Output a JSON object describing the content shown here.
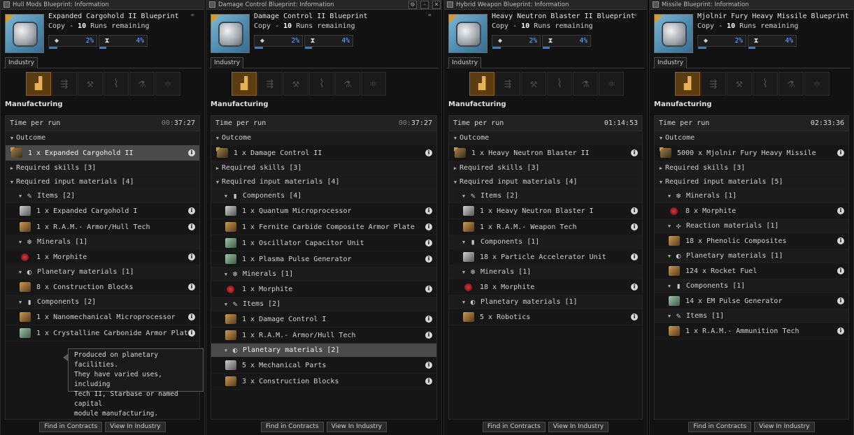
{
  "windows": [
    {
      "title": "Hull Mods Blueprint: Information",
      "name": "Expanded Cargohold II Blueprint",
      "copy_text": "Copy - ",
      "runs": "10",
      "runs_suffix": " Runs remaining",
      "me": "2%",
      "te": "4%",
      "tab": "Industry",
      "section": "Manufacturing",
      "time_label": "Time per run",
      "time_dim": "00:",
      "time": "37:27",
      "rows": [
        {
          "t": "hdr",
          "indent": 0,
          "label": "Outcome"
        },
        {
          "t": "item",
          "indent": 0,
          "label": "1 x Expanded Cargohold II",
          "icon": "bp",
          "sel": true,
          "info": true
        },
        {
          "t": "hdr",
          "indent": 0,
          "label": "Required skills [3]",
          "collapsed": true
        },
        {
          "t": "hdr",
          "indent": 0,
          "label": "Required input materials [4]"
        },
        {
          "t": "sub",
          "indent": 1,
          "label": "Items [2]",
          "glyph": "✎"
        },
        {
          "t": "item",
          "indent": 1,
          "label": "1 x Expanded Cargohold I",
          "icon": "gray",
          "info": true
        },
        {
          "t": "item",
          "indent": 1,
          "label": "1 x R.A.M.- Armor/Hull Tech",
          "icon": "brown",
          "info": true
        },
        {
          "t": "sub",
          "indent": 1,
          "label": "Minerals [1]",
          "glyph": "❄"
        },
        {
          "t": "item",
          "indent": 1,
          "label": "1 x Morphite",
          "icon": "red",
          "info": true
        },
        {
          "t": "sub",
          "indent": 1,
          "label": "Planetary materials [1]",
          "glyph": "◐"
        },
        {
          "t": "item",
          "indent": 1,
          "label": "8 x Construction Blocks",
          "icon": "brown",
          "info": true
        },
        {
          "t": "sub",
          "indent": 1,
          "label": "Components [2]",
          "glyph": "▮"
        },
        {
          "t": "item",
          "indent": 1,
          "label": "1 x Nanomechanical Microprocessor",
          "icon": "brown",
          "info": true
        },
        {
          "t": "item",
          "indent": 1,
          "label": "1 x Crystalline Carbonide Armor Plate",
          "icon": "green",
          "info": true
        }
      ],
      "find_label": "Find in Contracts",
      "view_label": "View In Industry"
    },
    {
      "title": "Damage Control Blueprint: Information",
      "name": "Damage Control II Blueprint",
      "copy_text": "Copy - ",
      "runs": "10",
      "runs_suffix": " Runs remaining",
      "me": "2%",
      "te": "4%",
      "tab": "Industry",
      "section": "Manufacturing",
      "time_label": "Time per run",
      "time_dim": "00:",
      "time": "37:27",
      "rows": [
        {
          "t": "hdr",
          "indent": 0,
          "label": "Outcome"
        },
        {
          "t": "item",
          "indent": 0,
          "label": "1 x Damage Control II",
          "icon": "bp",
          "info": true
        },
        {
          "t": "hdr",
          "indent": 0,
          "label": "Required skills [3]",
          "collapsed": true
        },
        {
          "t": "hdr",
          "indent": 0,
          "label": "Required input materials [4]"
        },
        {
          "t": "sub",
          "indent": 1,
          "label": "Components [4]",
          "glyph": "▮"
        },
        {
          "t": "item",
          "indent": 1,
          "label": "1 x Quantum Microprocessor",
          "icon": "gray",
          "info": true
        },
        {
          "t": "item",
          "indent": 1,
          "label": "1 x Fernite Carbide Composite Armor Plate",
          "icon": "brown",
          "info": true
        },
        {
          "t": "item",
          "indent": 1,
          "label": "1 x Oscillator Capacitor Unit",
          "icon": "green",
          "info": true
        },
        {
          "t": "item",
          "indent": 1,
          "label": "1 x Plasma Pulse Generator",
          "icon": "green",
          "info": true
        },
        {
          "t": "sub",
          "indent": 1,
          "label": "Minerals [1]",
          "glyph": "❄"
        },
        {
          "t": "item",
          "indent": 1,
          "label": "1 x Morphite",
          "icon": "red",
          "info": true
        },
        {
          "t": "sub",
          "indent": 1,
          "label": "Items [2]",
          "glyph": "✎"
        },
        {
          "t": "item",
          "indent": 1,
          "label": "1 x Damage Control I",
          "icon": "brown",
          "info": true
        },
        {
          "t": "item",
          "indent": 1,
          "label": "1 x R.A.M.- Armor/Hull Tech",
          "icon": "brown",
          "info": true
        },
        {
          "t": "sub",
          "indent": 1,
          "label": "Planetary materials [2]",
          "glyph": "◐",
          "sel": true
        },
        {
          "t": "item",
          "indent": 1,
          "label": "5 x Mechanical Parts",
          "icon": "gray",
          "info": true
        },
        {
          "t": "item",
          "indent": 1,
          "label": "3 x Construction Blocks",
          "icon": "brown",
          "info": true
        }
      ],
      "find_label": "Find in Contracts",
      "view_label": "View In Industry"
    },
    {
      "title": "Hybrid Weapon Blueprint: Information",
      "name": "Heavy Neutron Blaster II Blueprint",
      "copy_text": "Copy - ",
      "runs": "10",
      "runs_suffix": " Runs remaining",
      "me": "2%",
      "te": "4%",
      "tab": "Industry",
      "section": "Manufacturing",
      "time_label": "Time per run",
      "time_dim": "",
      "time": "01:14:53",
      "rows": [
        {
          "t": "hdr",
          "indent": 0,
          "label": "Outcome"
        },
        {
          "t": "item",
          "indent": 0,
          "label": "1 x Heavy Neutron Blaster II",
          "icon": "bp",
          "info": true
        },
        {
          "t": "hdr",
          "indent": 0,
          "label": "Required skills [3]",
          "collapsed": true
        },
        {
          "t": "hdr",
          "indent": 0,
          "label": "Required input materials [4]"
        },
        {
          "t": "sub",
          "indent": 1,
          "label": "Items [2]",
          "glyph": "✎"
        },
        {
          "t": "item",
          "indent": 1,
          "label": "1 x Heavy Neutron Blaster I",
          "icon": "gray",
          "info": true
        },
        {
          "t": "item",
          "indent": 1,
          "label": "1 x R.A.M.- Weapon Tech",
          "icon": "brown",
          "info": true
        },
        {
          "t": "sub",
          "indent": 1,
          "label": "Components [1]",
          "glyph": "▮"
        },
        {
          "t": "item",
          "indent": 1,
          "label": "18 x Particle Accelerator Unit",
          "icon": "gray",
          "info": true
        },
        {
          "t": "sub",
          "indent": 1,
          "label": "Minerals [1]",
          "glyph": "❄"
        },
        {
          "t": "item",
          "indent": 1,
          "label": "18 x Morphite",
          "icon": "red",
          "info": true
        },
        {
          "t": "sub",
          "indent": 1,
          "label": "Planetary materials [1]",
          "glyph": "◐"
        },
        {
          "t": "item",
          "indent": 1,
          "label": "5 x Robotics",
          "icon": "brown",
          "info": true
        }
      ],
      "find_label": "Find in Contracts",
      "view_label": "View In Industry"
    },
    {
      "title": "Missile Blueprint: Information",
      "name": "Mjolnir Fury Heavy Missile Blueprint",
      "copy_text": "Copy - ",
      "runs": "10",
      "runs_suffix": " Runs remaining",
      "me": "2%",
      "te": "4%",
      "tab": "Industry",
      "section": "Manufacturing",
      "time_label": "Time per run",
      "time_dim": "",
      "time": "02:33:36",
      "rows": [
        {
          "t": "hdr",
          "indent": 0,
          "label": "Outcome"
        },
        {
          "t": "item",
          "indent": 0,
          "label": "5000 x Mjolnir Fury Heavy Missile",
          "icon": "bp",
          "info": true
        },
        {
          "t": "hdr",
          "indent": 0,
          "label": "Required skills [3]",
          "collapsed": true
        },
        {
          "t": "hdr",
          "indent": 0,
          "label": "Required input materials [5]"
        },
        {
          "t": "sub",
          "indent": 1,
          "label": "Minerals [1]",
          "glyph": "❄"
        },
        {
          "t": "item",
          "indent": 1,
          "label": "8 x Morphite",
          "icon": "red",
          "info": true
        },
        {
          "t": "sub",
          "indent": 1,
          "label": "Reaction materials [1]",
          "glyph": "✣"
        },
        {
          "t": "item",
          "indent": 1,
          "label": "18 x Phenolic Composites",
          "icon": "brown",
          "info": true
        },
        {
          "t": "sub",
          "indent": 1,
          "label": "Planetary materials [1]",
          "glyph": "◐"
        },
        {
          "t": "item",
          "indent": 1,
          "label": "124 x Rocket Fuel",
          "icon": "brown",
          "info": true
        },
        {
          "t": "sub",
          "indent": 1,
          "label": "Components [1]",
          "glyph": "▮"
        },
        {
          "t": "item",
          "indent": 1,
          "label": "14 x EM Pulse Generator",
          "icon": "green",
          "info": true
        },
        {
          "t": "sub",
          "indent": 1,
          "label": "Items [1]",
          "glyph": "✎"
        },
        {
          "t": "item",
          "indent": 1,
          "label": "1 x R.A.M.- Ammunition Tech",
          "icon": "brown",
          "info": true
        }
      ],
      "find_label": "Find in Contracts",
      "view_label": "View In Industry"
    }
  ],
  "tooltip": {
    "lines": [
      "Produced on planetary facilities.",
      "They have varied uses, including",
      "Tech II, Starbase or named capital",
      "module manufacturing."
    ]
  },
  "activity_icons": [
    "manufacturing-icon",
    "research-te-icon",
    "research-me-icon",
    "copying-icon",
    "invention-icon",
    "reactions-icon"
  ],
  "colors": {
    "accent": "#2b7ed1",
    "selected_activity": "#5c3d12",
    "selected_row": "#4a4a4a"
  }
}
